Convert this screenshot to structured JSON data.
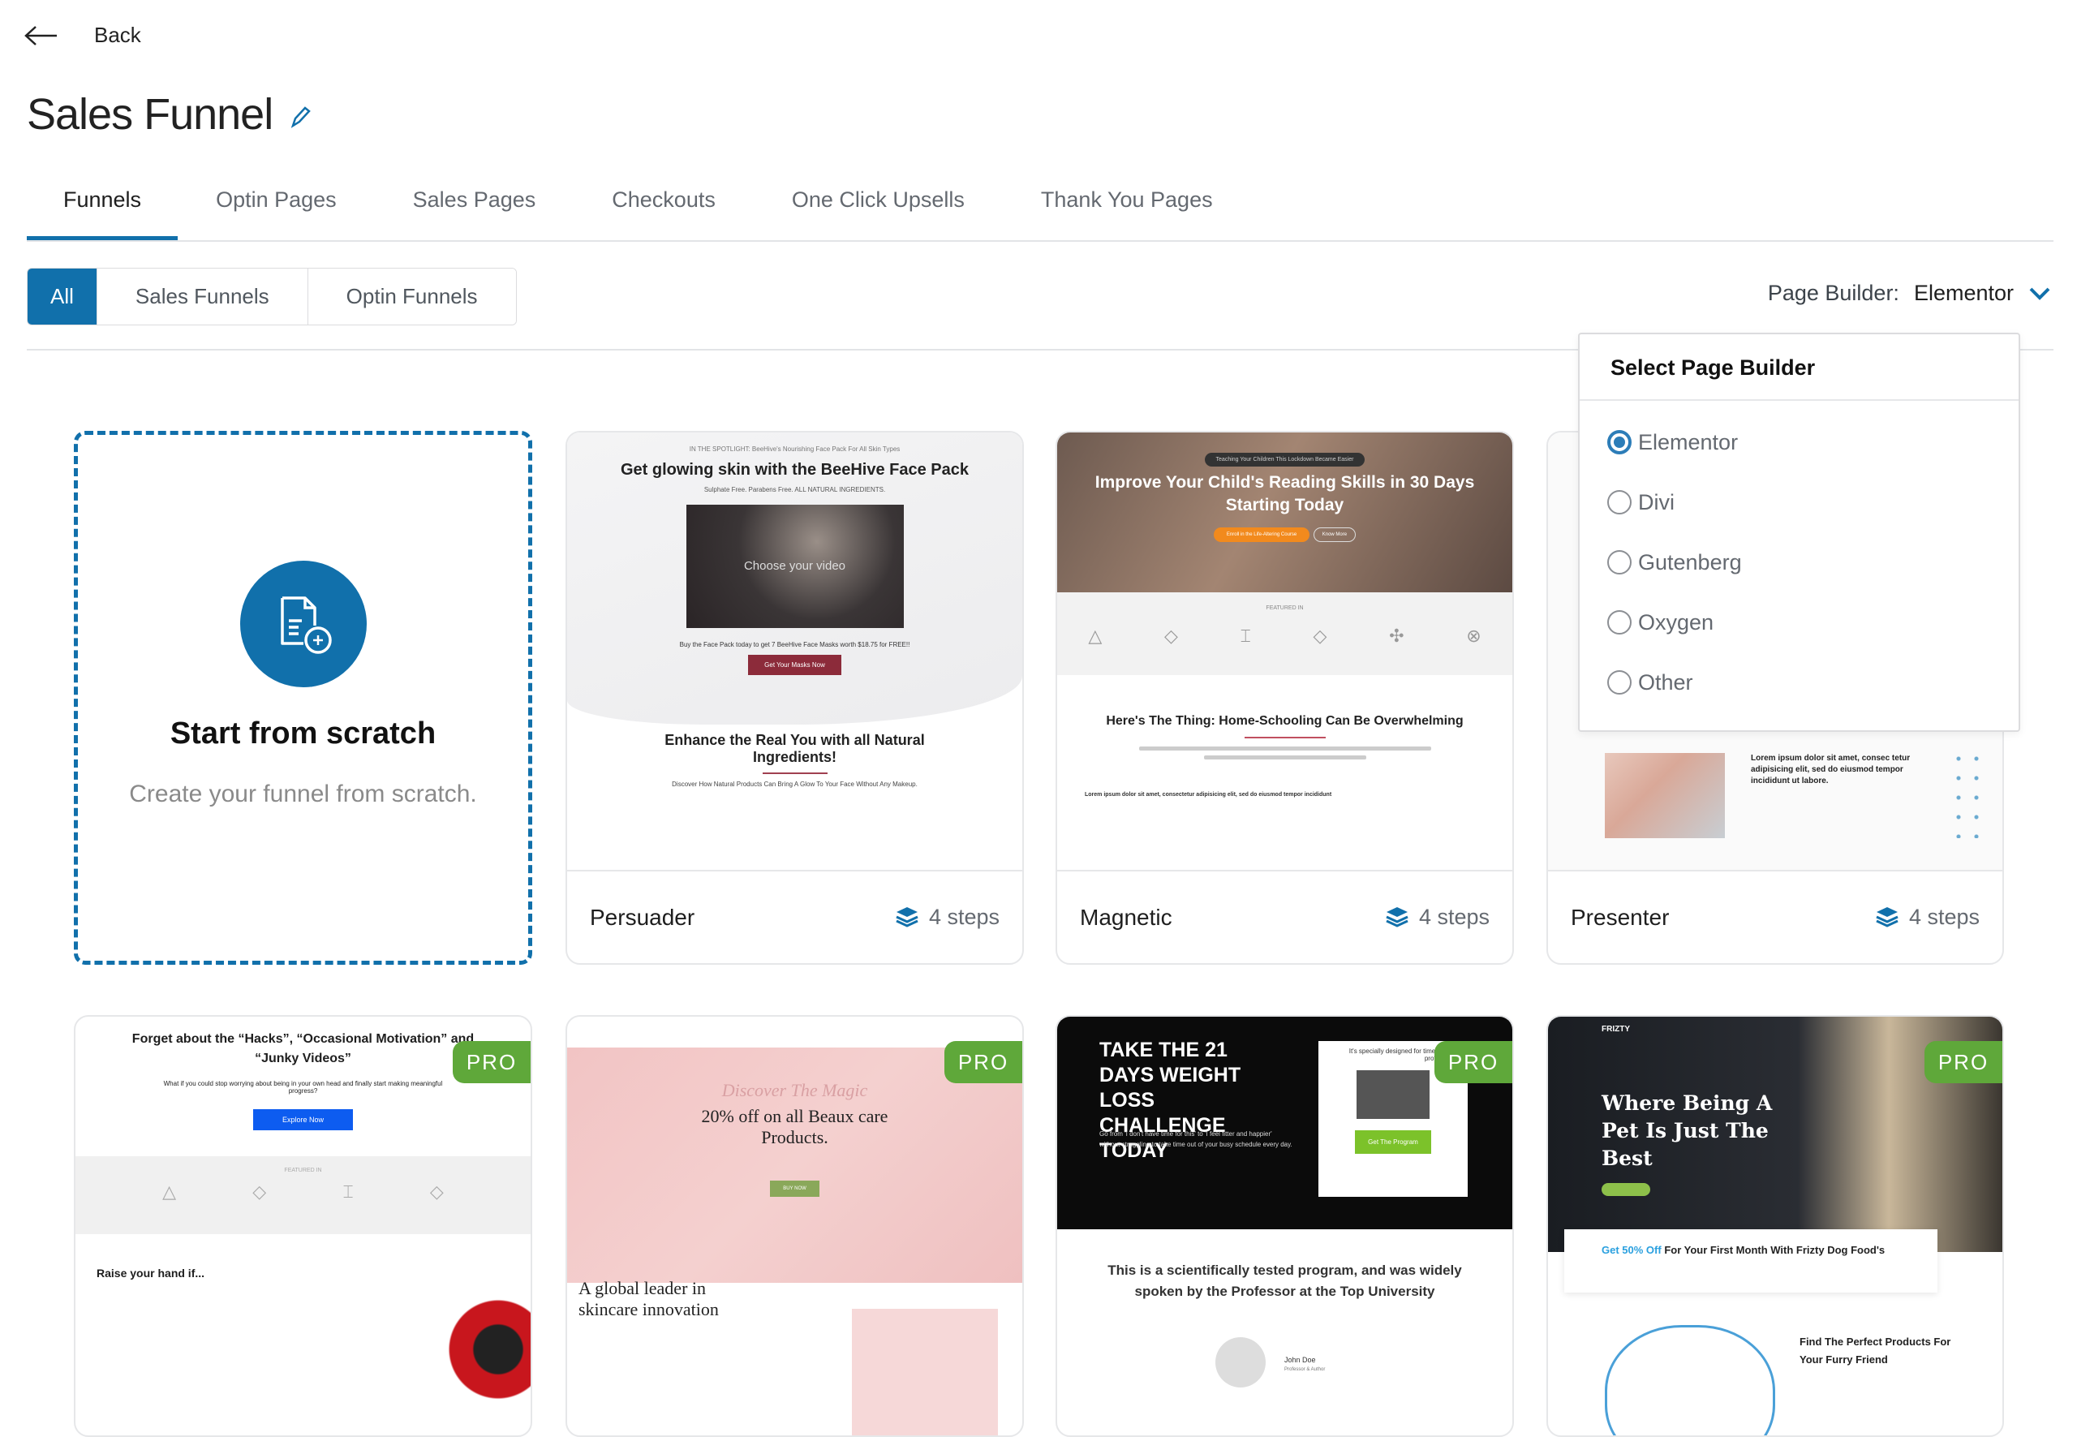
{
  "nav": {
    "back_label": "Back"
  },
  "page": {
    "title": "Sales Funnel"
  },
  "tabs": [
    {
      "label": "Funnels",
      "active": true
    },
    {
      "label": "Optin Pages"
    },
    {
      "label": "Sales Pages"
    },
    {
      "label": "Checkouts"
    },
    {
      "label": "One Click Upsells"
    },
    {
      "label": "Thank You Pages"
    }
  ],
  "filters": [
    {
      "label": "All",
      "active": true
    },
    {
      "label": "Sales Funnels"
    },
    {
      "label": "Optin Funnels"
    }
  ],
  "page_builder": {
    "label": "Page Builder:",
    "value": "Elementor",
    "dropdown": {
      "title": "Select Page Builder",
      "options": [
        "Elementor",
        "Divi",
        "Gutenberg",
        "Oxygen",
        "Other"
      ],
      "selected": "Elementor"
    }
  },
  "scratch": {
    "title": "Start from scratch",
    "subtitle": "Create your funnel from scratch."
  },
  "templates": [
    {
      "name": "Persuader",
      "steps": "4 steps",
      "preview": {
        "kicker": "IN THE SPOTLIGHT: BeeHive's Nourishing Face Pack For All Skin Types",
        "headline": "Get glowing skin with the BeeHive Face Pack",
        "sub": "Sulphate Free. Parabens Free. ALL NATURAL INGREDIENTS.",
        "video": "Choose your video",
        "offer": "Buy the Face Pack today to get 7 BeeHive Face Masks worth $18.75 for FREE!!",
        "cta": "Get Your Masks Now",
        "headline2": "Enhance the Real You with all Natural Ingredients!",
        "sub2": "Discover How Natural Products Can Bring A Glow To Your Face Without Any Makeup."
      }
    },
    {
      "name": "Magnetic",
      "steps": "4 steps",
      "preview": {
        "kicker": "Teaching Your Children This Lockdown Became Easier",
        "headline": "Improve Your Child's Reading Skills in 30 Days Starting Today",
        "cta": "Enroll in the Life-Altering Course",
        "cta2": "Know More",
        "featured": "FEATURED IN",
        "headline2": "Here's The Thing: Home-Schooling Can Be Overwhelming",
        "bullet": "Lorem ipsum dolor sit amet, consectetur adipisicing elit, sed do eiusmod tempor incididunt"
      }
    },
    {
      "name": "Presenter",
      "steps": "4 steps",
      "preview": {
        "text": "Lorem ipsum dolor sit amet, consec tetur adipisicing elit, sed do eiusmod tempor incididunt ut labore."
      }
    },
    {
      "badge": "PRO",
      "preview": {
        "headline": "Forget about the “Hacks”, “Occasional Motivation” and “Junky Videos”",
        "sub": "What if you could stop worrying about being in your own head and finally start making meaningful progress?",
        "cta": "Explore Now",
        "featured": "FEATURED IN",
        "headline2": "Raise your hand if..."
      }
    },
    {
      "badge": "PRO",
      "preview": {
        "script": "Discover The Magic",
        "headline": "20% off on all Beaux care Products.",
        "cta": "BUY NOW",
        "headline2": "A global leader in skincare innovation"
      }
    },
    {
      "badge": "PRO",
      "preview": {
        "headline": "TAKE THE 21 DAYS WEIGHT LOSS CHALLENGE TODAY",
        "sub": "Go from 'I don't have time for this' to 'I feel fitter and happier' without struggling to take time out of your busy schedule every day.",
        "box": "It's specially designed for time-strapped professionals",
        "cta": "Get The Program",
        "headline2": "This is a scientifically tested program, and was widely spoken by the Professor at the Top University",
        "person": "John Doe",
        "role": "Professor & Author"
      }
    },
    {
      "badge": "PRO",
      "preview": {
        "brand": "FRIZTY",
        "headline": "Where Being A Pet Is Just The Best",
        "offer_hl": "Get 50% Off",
        "offer": "For Your First Month With Frizty Dog Food's",
        "headline2": "Find The Perfect Products For Your Furry Friend"
      }
    }
  ],
  "colors": {
    "accent": "#1170ab",
    "pro": "#5fa83a"
  }
}
